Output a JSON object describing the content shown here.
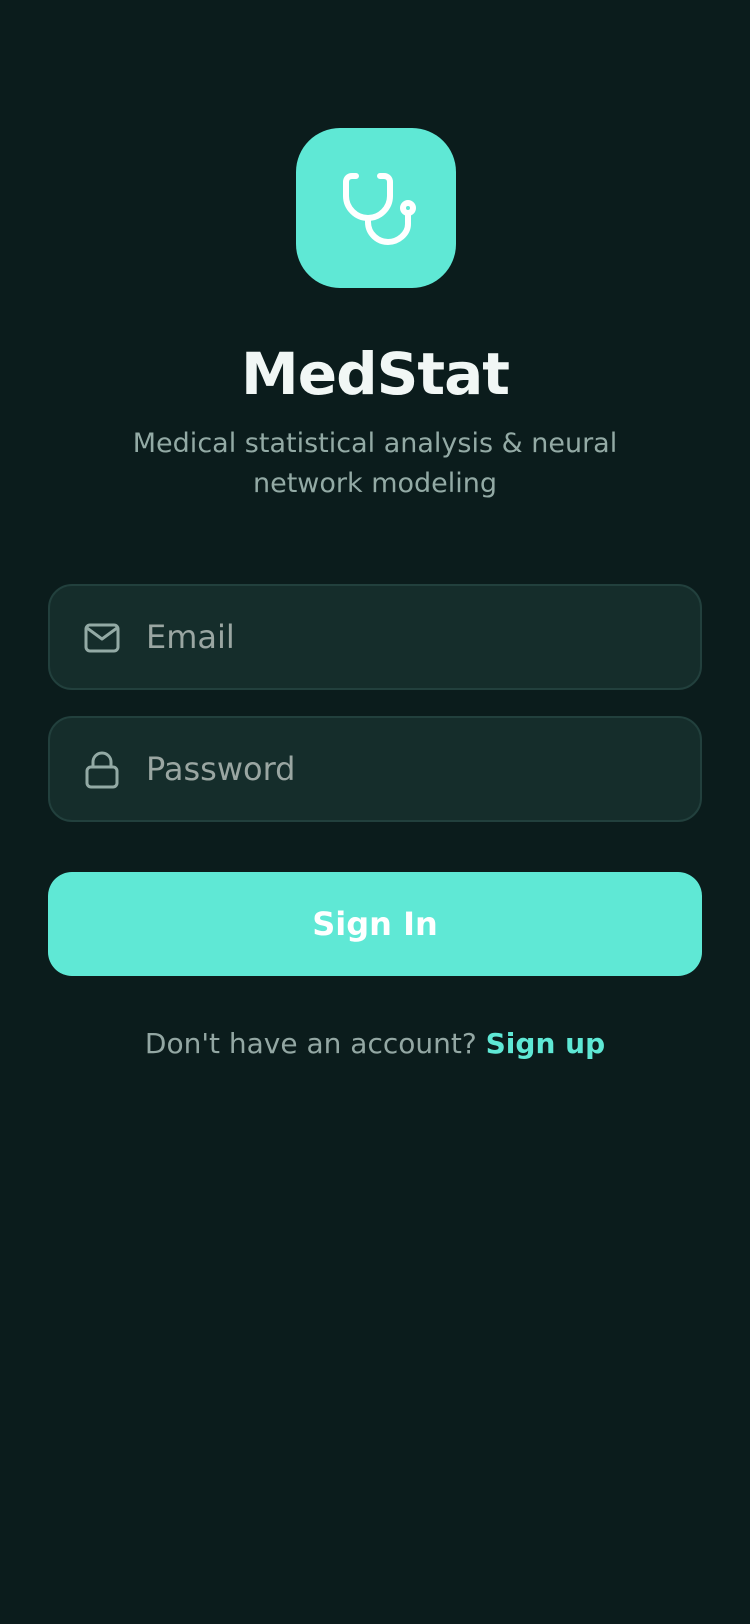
{
  "app": {
    "logo_icon": "stethoscope-icon",
    "title": "MedStat",
    "subtitle": "Medical statistical analysis & neural network modeling"
  },
  "form": {
    "email": {
      "icon": "mail-icon",
      "placeholder": "Email",
      "value": ""
    },
    "password": {
      "icon": "lock-icon",
      "placeholder": "Password",
      "value": ""
    },
    "submit_label": "Sign In"
  },
  "signup": {
    "prompt": "Don't have an account?",
    "link_label": "Sign up"
  },
  "colors": {
    "background": "#0b1c1c",
    "accent": "#5fe8d5",
    "field_background": "#152d2b",
    "field_border": "#22403d",
    "muted_text": "#93aaa5",
    "title_text": "#f1f7f5"
  }
}
